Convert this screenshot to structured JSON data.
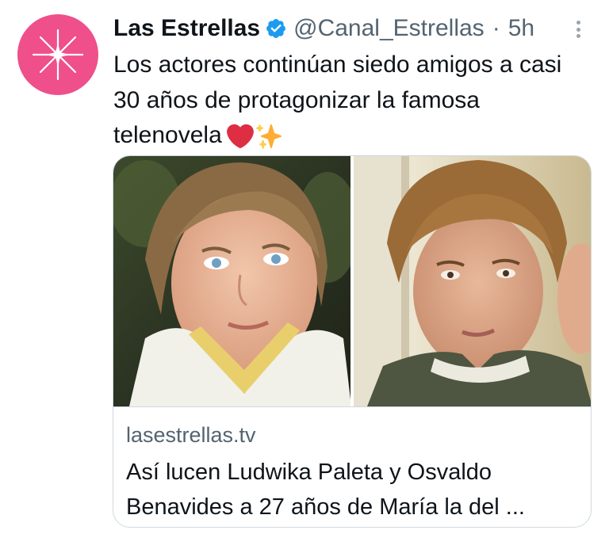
{
  "tweet": {
    "display_name": "Las Estrellas",
    "handle": "@Canal_Estrellas",
    "separator": "·",
    "time": "5h",
    "text": "Los actores continúan siedo amigos a casi 30 años de protagonizar la famosa telenovela",
    "emojis": [
      "red-heart",
      "sparkles"
    ]
  },
  "colors": {
    "avatar_bg": "#ef4f8a",
    "verified": "#1d9bf0",
    "text": "#0f1419",
    "secondary": "#536471",
    "border": "#cfd9de"
  },
  "link_card": {
    "domain": "lasestrellas.tv",
    "title": "Así lucen Ludwika Paleta y Osvaldo Benavides a 27 años de María la del ..."
  }
}
